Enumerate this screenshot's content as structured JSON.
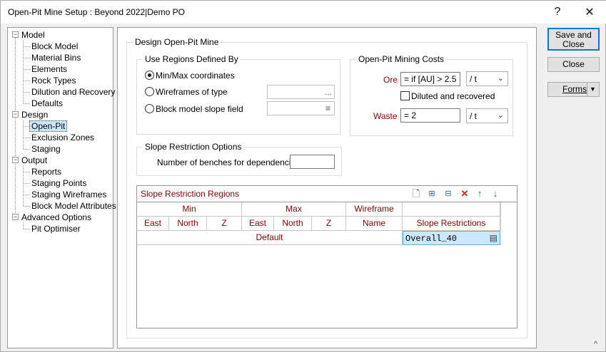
{
  "window": {
    "title": "Open-Pit Mine Setup : Beyond 2022|Demo PO",
    "help_label": "?",
    "close_label": "✕",
    "resize_label": "^"
  },
  "tree": {
    "model": "Model",
    "model_items": [
      "Block Model",
      "Material Bins",
      "Elements",
      "Rock Types",
      "Dilution and Recovery",
      "Defaults"
    ],
    "design": "Design",
    "design_items": [
      "Open-Pit",
      "Exclusion Zones",
      "Staging"
    ],
    "output": "Output",
    "output_items": [
      "Reports",
      "Staging Points",
      "Staging Wireframes",
      "Block Model Attributes"
    ],
    "advanced": "Advanced Options",
    "advanced_items": [
      "Pit Optimiser"
    ],
    "expander": "−"
  },
  "main": {
    "group_title": "Design Open-Pit Mine",
    "regions": {
      "title": "Use Regions Defined By",
      "options": [
        "Min/Max coordinates",
        "Wireframes of type",
        "Block model slope field"
      ],
      "selected": 0,
      "browse_label": "...",
      "list_label": "≡"
    },
    "costs": {
      "title": "Open-Pit Mining Costs",
      "ore_label": "Ore",
      "ore_value": "=  if [AU] > 2.5",
      "ore_unit": "/ t",
      "diluted_label": "Diluted and recovered",
      "waste_label": "Waste",
      "waste_value": "=  2",
      "waste_unit": "/ t"
    },
    "slope": {
      "title": "Slope Restriction Options",
      "benches_label": "Number of benches for dependencies",
      "benches_value": ""
    },
    "grid": {
      "title": "Slope Restriction Regions",
      "group_headers": [
        "Min",
        "Max",
        "Wireframe"
      ],
      "col_headers": [
        "East",
        "North",
        "Z",
        "East",
        "North",
        "Z",
        "Name",
        "Slope Restrictions"
      ],
      "default_label": "Default",
      "default_slope": "Overall_40"
    }
  },
  "buttons": {
    "save_close": "Save and Close",
    "close": "Close",
    "forms": "Forms"
  }
}
